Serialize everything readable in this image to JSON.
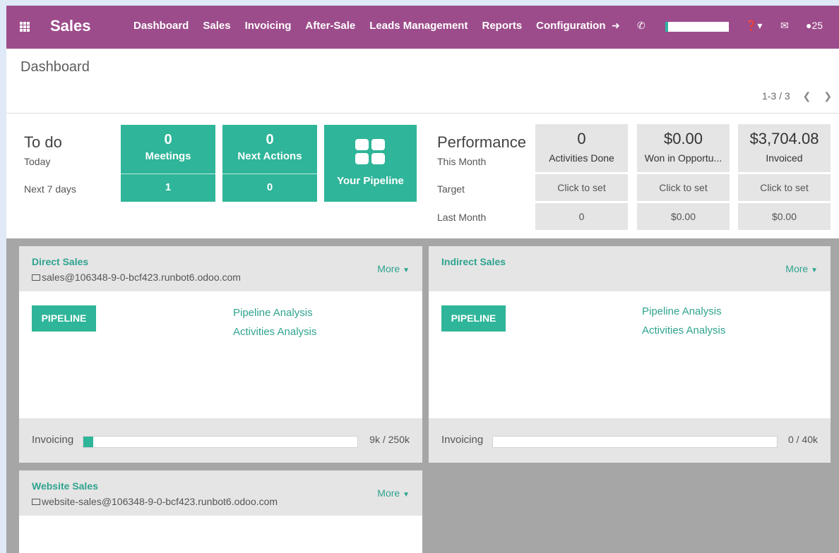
{
  "topbar": {
    "app_name": "Sales",
    "menu": [
      "Dashboard",
      "Sales",
      "Invoicing",
      "After-Sale",
      "Leads Management",
      "Reports",
      "Configuration"
    ],
    "icons": [
      "sign-in-icon",
      "phone-icon",
      "help-icon",
      "mail-icon",
      "chat-icon"
    ],
    "chat_count": "25",
    "colors": {
      "bar": "#9c4c8b",
      "accent": "#2fb599"
    }
  },
  "control_panel": {
    "breadcrumb": "Dashboard",
    "pager": "1-3 / 3"
  },
  "todo": {
    "title": "To do",
    "today_label": "Today",
    "next7_label": "Next 7 days",
    "meetings": {
      "today": "0",
      "label": "Meetings",
      "week": "1"
    },
    "next_actions": {
      "today": "0",
      "label": "Next Actions",
      "week": "0"
    },
    "pipeline_label": "Your Pipeline"
  },
  "performance": {
    "title": "Performance",
    "this_month": "This Month",
    "target": "Target",
    "last_month": "Last Month",
    "columns": [
      {
        "value": "0",
        "label": "Activities Done",
        "target": "Click to set",
        "last": "0"
      },
      {
        "value": "$0.00",
        "label": "Won in Opportu...",
        "target": "Click to set",
        "last": "$0.00"
      },
      {
        "value": "$3,704.08",
        "label": "Invoiced",
        "target": "Click to set",
        "last": "$0.00"
      }
    ]
  },
  "teams": [
    {
      "name": "Direct Sales",
      "email": "sales@106348-9-0-bcf423.runbot6.odoo.com",
      "more": "More",
      "pipeline_btn": "PIPELINE",
      "links": [
        "Pipeline Analysis",
        "Activities Analysis"
      ],
      "invoicing_label": "Invoicing",
      "invoicing_value": "9k / 250k",
      "invoicing_progress": 0.036
    },
    {
      "name": "Indirect Sales",
      "email": "",
      "more": "More",
      "pipeline_btn": "PIPELINE",
      "links": [
        "Pipeline Analysis",
        "Activities Analysis"
      ],
      "invoicing_label": "Invoicing",
      "invoicing_value": "0 / 40k",
      "invoicing_progress": 0
    },
    {
      "name": "Website Sales",
      "email": "website-sales@106348-9-0-bcf423.runbot6.odoo.com",
      "more": "More"
    }
  ]
}
